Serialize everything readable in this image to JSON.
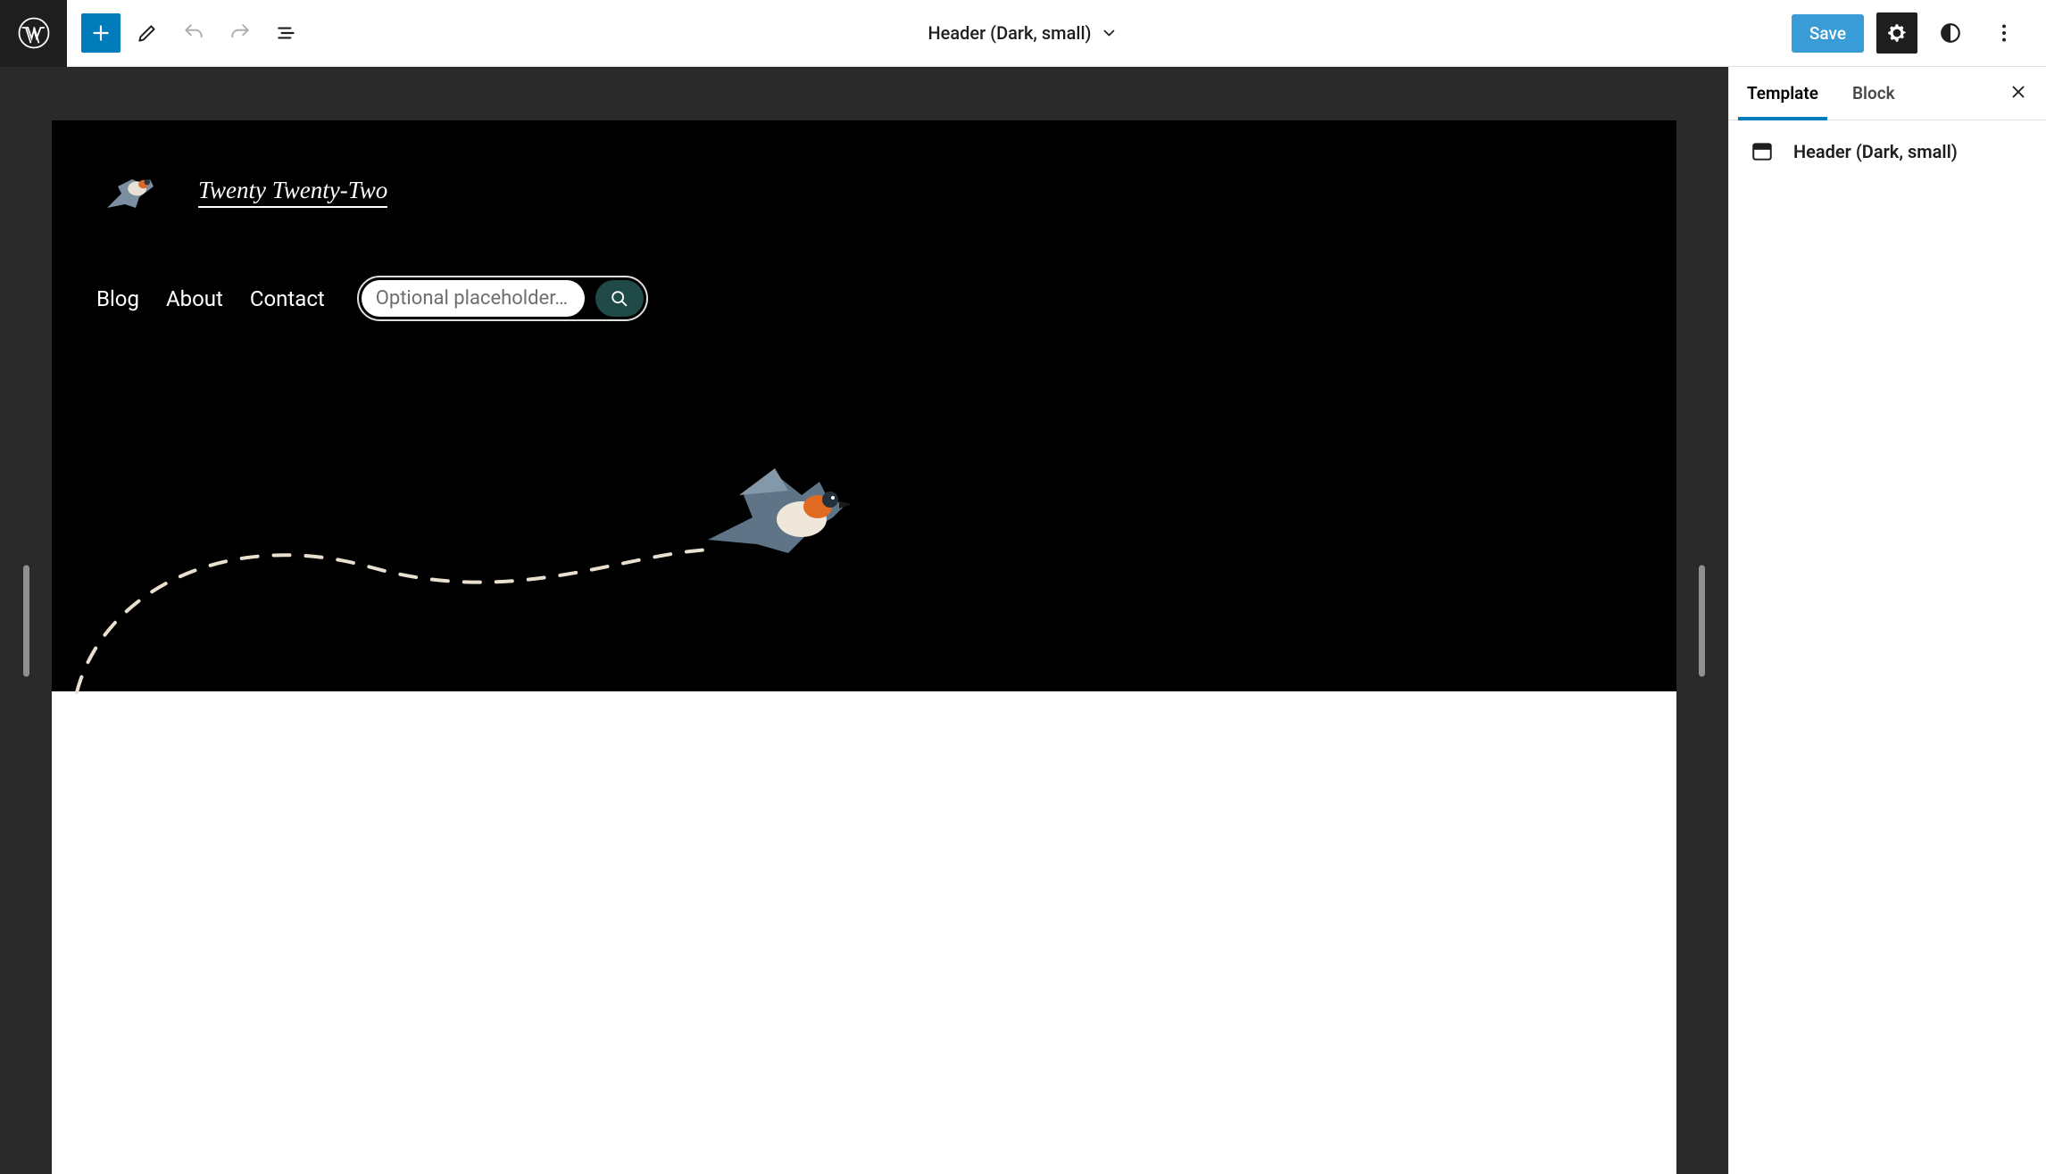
{
  "toolbar": {
    "title": "Header (Dark, small)",
    "save_label": "Save"
  },
  "sidebar": {
    "tabs": {
      "template": "Template",
      "block": "Block"
    },
    "template_name": "Header (Dark, small)"
  },
  "preview": {
    "site_title": "Twenty Twenty-Two",
    "nav": {
      "blog": "Blog",
      "about": "About",
      "contact": "Contact"
    },
    "search": {
      "placeholder": "Optional placeholder…"
    }
  }
}
